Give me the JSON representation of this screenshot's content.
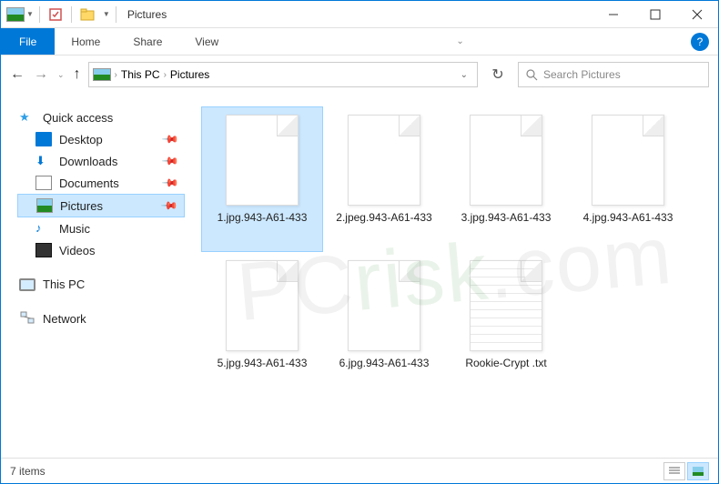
{
  "title": "Pictures",
  "ribbon": {
    "file": "File",
    "tabs": [
      "Home",
      "Share",
      "View"
    ]
  },
  "breadcrumb": {
    "parts": [
      "This PC",
      "Pictures"
    ]
  },
  "search": {
    "placeholder": "Search Pictures"
  },
  "sidebar": {
    "quick_access": "Quick access",
    "items": [
      {
        "label": "Desktop",
        "pinned": true
      },
      {
        "label": "Downloads",
        "pinned": true
      },
      {
        "label": "Documents",
        "pinned": true
      },
      {
        "label": "Pictures",
        "pinned": true,
        "current": true
      },
      {
        "label": "Music",
        "pinned": false
      },
      {
        "label": "Videos",
        "pinned": false
      }
    ],
    "this_pc": "This PC",
    "network": "Network"
  },
  "files": [
    {
      "name": "1.jpg.943-A61-433",
      "type": "file",
      "selected": true
    },
    {
      "name": "2.jpeg.943-A61-433",
      "type": "file"
    },
    {
      "name": "3.jpg.943-A61-433",
      "type": "file"
    },
    {
      "name": "4.jpg.943-A61-433",
      "type": "file"
    },
    {
      "name": "5.jpg.943-A61-433",
      "type": "file"
    },
    {
      "name": "6.jpg.943-A61-433",
      "type": "file"
    },
    {
      "name": "Rookie-Crypt .txt",
      "type": "txt"
    }
  ],
  "status": {
    "count": "7 items"
  },
  "colors": {
    "accent": "#0078d7",
    "selection": "#cce8ff"
  }
}
